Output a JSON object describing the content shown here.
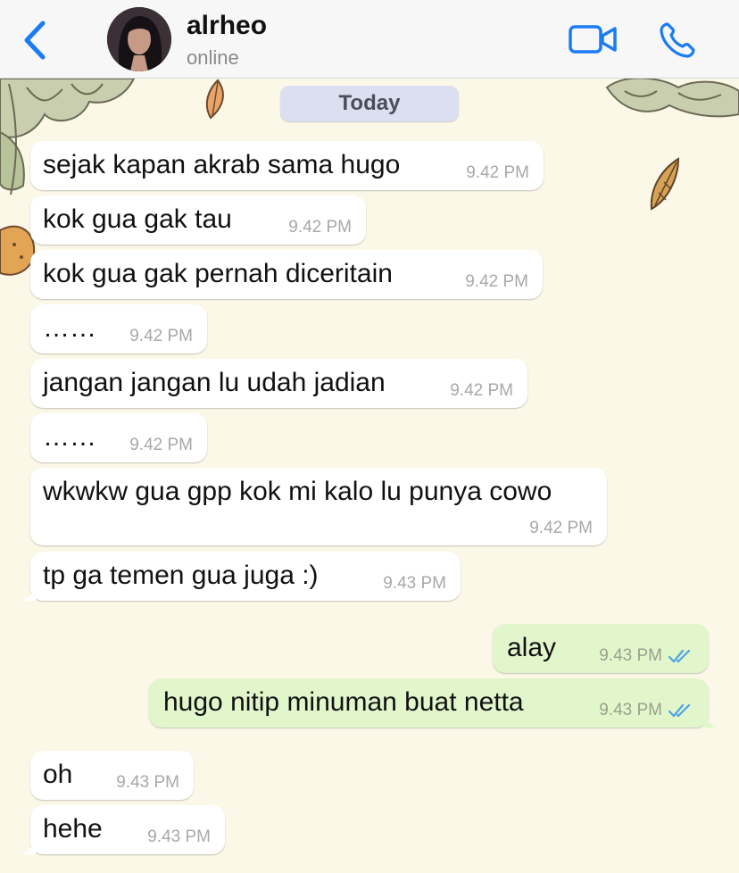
{
  "header": {
    "back_label": "back",
    "contact_name": "alrheo",
    "contact_status": "online"
  },
  "date_separator": "Today",
  "messages": [
    {
      "text": "sejak kapan akrab sama hugo",
      "time": "9.42 PM",
      "direction": "in"
    },
    {
      "text": "kok gua gak tau",
      "time": "9.42 PM",
      "direction": "in"
    },
    {
      "text": "kok gua gak pernah diceritain",
      "time": "9.42 PM",
      "direction": "in"
    },
    {
      "text": "……",
      "time": "9.42 PM",
      "direction": "in"
    },
    {
      "text": "jangan jangan lu udah jadian",
      "time": "9.42 PM",
      "direction": "in"
    },
    {
      "text": "……",
      "time": "9.42 PM",
      "direction": "in"
    },
    {
      "text": "wkwkw gua gpp kok mi kalo lu punya cowo",
      "time": "9.42 PM",
      "direction": "in"
    },
    {
      "text": "tp ga temen gua juga :)",
      "time": "9.43 PM",
      "direction": "in"
    },
    {
      "text": "alay",
      "time": "9.43 PM",
      "direction": "out",
      "status": "read"
    },
    {
      "text": "hugo nitip minuman buat netta",
      "time": "9.43 PM",
      "direction": "out",
      "status": "read"
    },
    {
      "text": "oh",
      "time": "9.43 PM",
      "direction": "in"
    },
    {
      "text": "hehe",
      "time": "9.43 PM",
      "direction": "in"
    }
  ],
  "colors": {
    "accent": "#1a7cf5",
    "incoming_bubble": "#ffffff",
    "outgoing_bubble": "#e1f7cb",
    "read_ticks": "#4fa3e0",
    "wallpaper": "#fbf8e8"
  },
  "icons": [
    "chevron-left-icon",
    "video-call-icon",
    "phone-icon",
    "double-check-icon"
  ]
}
